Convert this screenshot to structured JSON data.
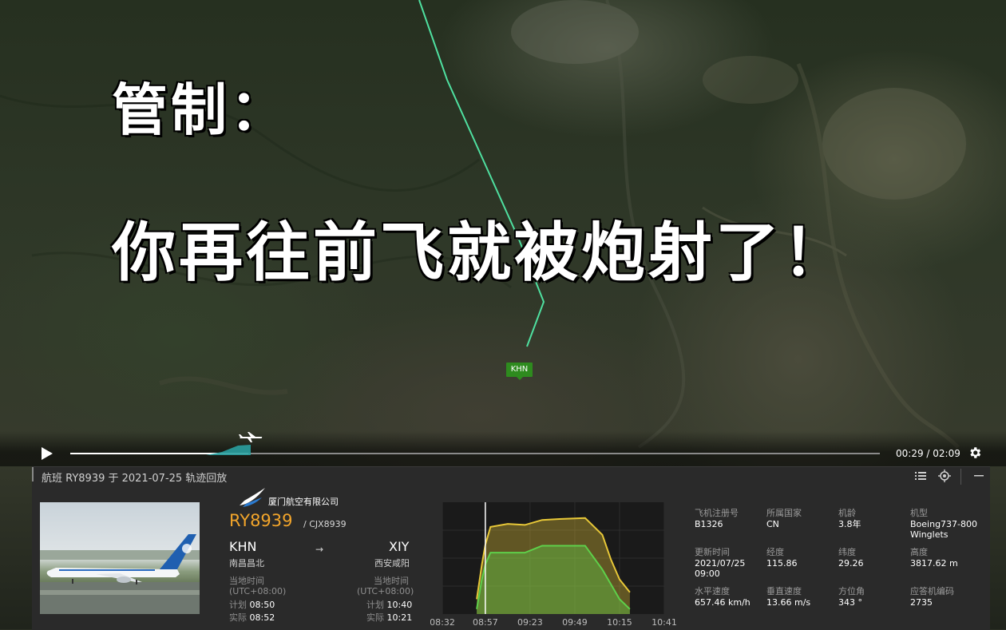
{
  "caption": {
    "line1": "管制：",
    "line2": "你再往前飞就被炮射了！"
  },
  "map": {
    "airport_label": "KHN",
    "route_color": "#4fe0a0"
  },
  "player": {
    "time_readout": "00:29 / 02:09",
    "progress": 0.22
  },
  "panel": {
    "title": "航班 RY8939 于 2021-07-25 轨迹回放",
    "airline_name": "厦门航空有限公司",
    "flight_number": "RY8939",
    "flight_alt_code": "/ CJX8939",
    "origin": {
      "code": "KHN",
      "city": "南昌昌北",
      "local_label": "当地时间",
      "tz": "(UTC+08:00)",
      "planned_label": "计划",
      "planned": "08:50",
      "actual_label": "实际",
      "actual": "08:52"
    },
    "destination": {
      "code": "XIY",
      "city": "西安咸阳",
      "local_label": "当地时间",
      "tz": "(UTC+08:00)",
      "planned_label": "计划",
      "planned": "10:40",
      "actual_label": "实际",
      "actual": "10:21"
    },
    "arrow": "→"
  },
  "chart_data": {
    "type": "area",
    "x_ticks": [
      "08:32",
      "08:57",
      "09:23",
      "09:49",
      "10:15",
      "10:41"
    ],
    "current_time_marker": "08:57",
    "series": [
      {
        "color": "#e8c838",
        "x": [
          "08:52",
          "08:55",
          "08:57",
          "09:00",
          "09:10",
          "09:20",
          "09:30",
          "09:40",
          "09:55",
          "10:05",
          "10:10",
          "10:15",
          "10:21"
        ],
        "values": [
          0.15,
          0.5,
          0.7,
          0.88,
          0.91,
          0.9,
          0.95,
          0.96,
          0.97,
          0.8,
          0.55,
          0.35,
          0.22
        ]
      },
      {
        "color": "#5ed04a",
        "x": [
          "08:52",
          "08:55",
          "08:57",
          "09:00",
          "09:20",
          "09:30",
          "09:55",
          "10:05",
          "10:10",
          "10:15",
          "10:21"
        ],
        "values": [
          0.05,
          0.35,
          0.5,
          0.62,
          0.62,
          0.69,
          0.69,
          0.45,
          0.3,
          0.15,
          0.05
        ]
      }
    ]
  },
  "details": [
    {
      "label": "飞机注册号",
      "value": "B1326"
    },
    {
      "label": "所属国家",
      "value": "CN"
    },
    {
      "label": "机龄",
      "value": "3.8年"
    },
    {
      "label": "机型",
      "value": "Boeing737-800 Winglets"
    },
    {
      "label": "更新时间",
      "value": "2021/07/25 09:00"
    },
    {
      "label": "经度",
      "value": "115.86"
    },
    {
      "label": "纬度",
      "value": "29.26"
    },
    {
      "label": "高度",
      "value": "3817.62 m"
    },
    {
      "label": "水平速度",
      "value": "657.46 km/h"
    },
    {
      "label": "垂直速度",
      "value": "13.66 m/s"
    },
    {
      "label": "方位角",
      "value": "343 °"
    },
    {
      "label": "应答机编码",
      "value": "2735"
    }
  ]
}
